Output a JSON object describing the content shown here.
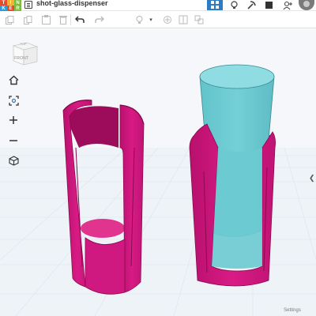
{
  "app": {
    "logo_letters": [
      "T",
      "I",
      "N",
      "K",
      "E",
      "R"
    ],
    "logo_colors": [
      "#e44d2e",
      "#f2b233",
      "#7dbb42",
      "#2c9bd6",
      "#e44d2e",
      "#7dbb42"
    ],
    "title": "shot-glass-dispenser"
  },
  "topbar": {
    "icons": [
      "3d-view-icon",
      "lightbulb-icon",
      "pickaxe-icon",
      "square-icon",
      "add-user-icon"
    ]
  },
  "toolbar": {
    "buttons": [
      "duplicate-icon",
      "copy-icon",
      "paste-icon",
      "delete-icon",
      "undo-icon",
      "redo-icon",
      "lightbulb-icon",
      "dropdown-icon"
    ]
  },
  "viewcube": {
    "top_label": "TOP",
    "front_label": "FRONT"
  },
  "controls": [
    "home-icon",
    "fit-icon",
    "zoom-in-icon",
    "zoom-out-icon",
    "perspective-icon"
  ],
  "settings_label": "Settings",
  "colors": {
    "magenta": "#d4147f",
    "magenta_dark": "#a20e5e",
    "teal": "#67c8cf",
    "accent_blue": "#2e7cc4",
    "grid": "#dfe6ee"
  }
}
